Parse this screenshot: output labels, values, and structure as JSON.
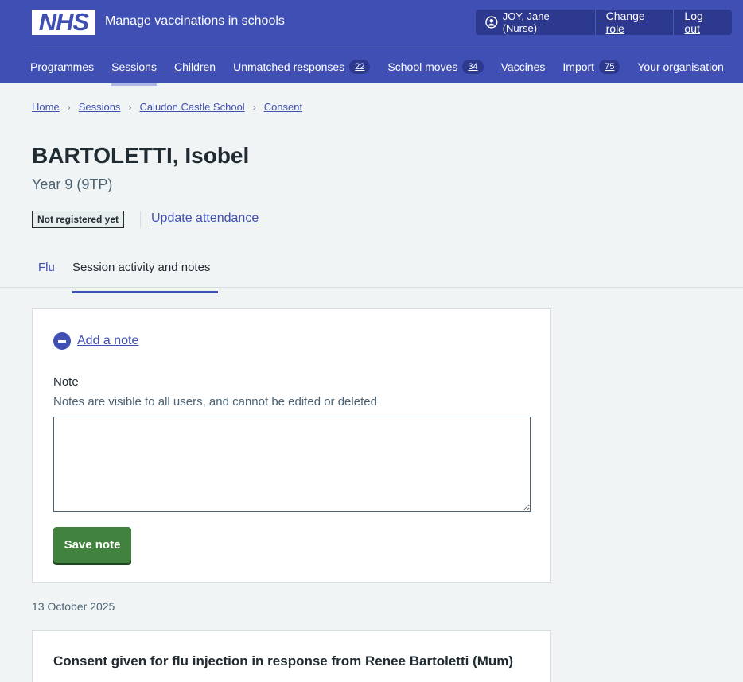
{
  "header": {
    "logo_text": "NHS",
    "service_name": "Manage vaccinations in schools",
    "account": {
      "user": "JOY, Jane (Nurse)",
      "change_role": "Change role",
      "log_out": "Log out"
    },
    "nav": [
      {
        "label": "Programmes",
        "badge": null
      },
      {
        "label": "Sessions",
        "badge": null,
        "current": true
      },
      {
        "label": "Children",
        "badge": null
      },
      {
        "label": "Unmatched responses",
        "badge": "22"
      },
      {
        "label": "School moves",
        "badge": "34"
      },
      {
        "label": "Vaccines",
        "badge": null
      },
      {
        "label": "Import",
        "badge": "75"
      },
      {
        "label": "Your organisation",
        "badge": null
      }
    ]
  },
  "breadcrumb": [
    "Home",
    "Sessions",
    "Caludon Castle School",
    "Consent"
  ],
  "patient": {
    "name": "BARTOLETTI, Isobel",
    "year": "Year 9 (9TP)",
    "status_tag": "Not registered yet",
    "update_attendance": "Update attendance"
  },
  "tabs": {
    "flu": "Flu",
    "activity": "Session activity and notes"
  },
  "note_form": {
    "toggle_label": "Add a note",
    "label": "Note",
    "hint": "Notes are visible to all users, and cannot be edited or deleted",
    "value": "",
    "save_label": "Save note"
  },
  "activity": {
    "date": "13 October 2025",
    "entry_title": "Consent given for flu injection in response from Renee Bartoletti (Mum)"
  },
  "colors": {
    "header": "#3f4fb4",
    "save_button": "#41823e"
  }
}
